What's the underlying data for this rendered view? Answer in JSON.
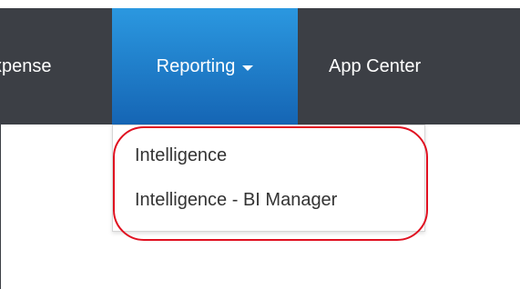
{
  "nav": {
    "items": [
      {
        "label": "xpense"
      },
      {
        "label": "Reporting"
      },
      {
        "label": "App Center"
      }
    ]
  },
  "dropdown": {
    "items": [
      {
        "label": "Intelligence"
      },
      {
        "label": "Intelligence - BI Manager"
      }
    ]
  },
  "colors": {
    "navbar": "#3c3f45",
    "active_tab_top": "#2b98e0",
    "active_tab_bottom": "#1565b4",
    "highlight": "#e01020"
  }
}
